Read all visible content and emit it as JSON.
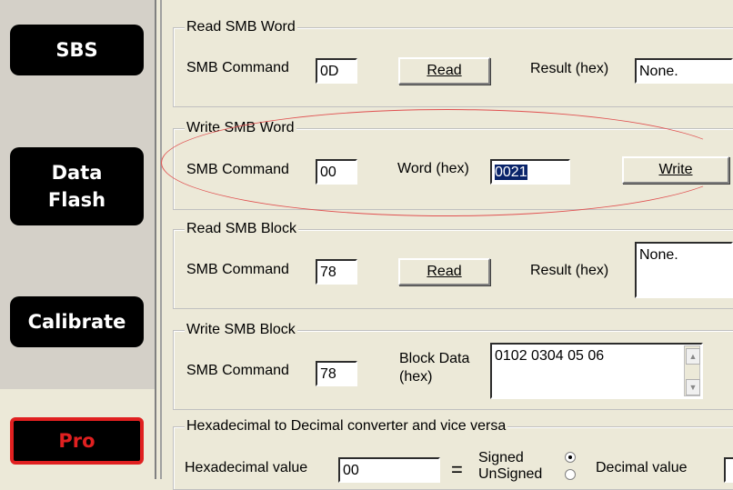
{
  "sidebar": {
    "sbs": "SBS",
    "data_flash_1": "Data",
    "data_flash_2": "Flash",
    "calibrate": "Calibrate",
    "pro": "Pro"
  },
  "read_word": {
    "legend": "Read SMB Word",
    "cmd_label": "SMB Command",
    "cmd_value": "0D",
    "read_btn": "Read",
    "result_label": "Result (hex)",
    "result_value": "None."
  },
  "write_word": {
    "legend": "Write SMB Word",
    "cmd_label": "SMB Command",
    "cmd_value": "00",
    "word_label": "Word (hex)",
    "word_value": "0021",
    "write_btn": "Write"
  },
  "read_block": {
    "legend": "Read SMB Block",
    "cmd_label": "SMB Command",
    "cmd_value": "78",
    "read_btn": "Read",
    "result_label": "Result (hex)",
    "result_value": "None."
  },
  "write_block": {
    "legend": "Write SMB Block",
    "cmd_label": "SMB Command",
    "cmd_value": "78",
    "block_label_1": "Block Data",
    "block_label_2": "(hex)",
    "block_value": "0102 0304 05  06"
  },
  "converter": {
    "legend": "Hexadecimal to Decimal converter and vice versa",
    "hex_label": "Hexadecimal value",
    "hex_value": "00",
    "equals": "=",
    "signed": "Signed",
    "unsigned": "UnSigned",
    "decimal_label": "Decimal value"
  },
  "colors": {
    "annotation_ellipse": "#e05050",
    "pro_border": "#e02020",
    "selection": "#0a246a"
  }
}
